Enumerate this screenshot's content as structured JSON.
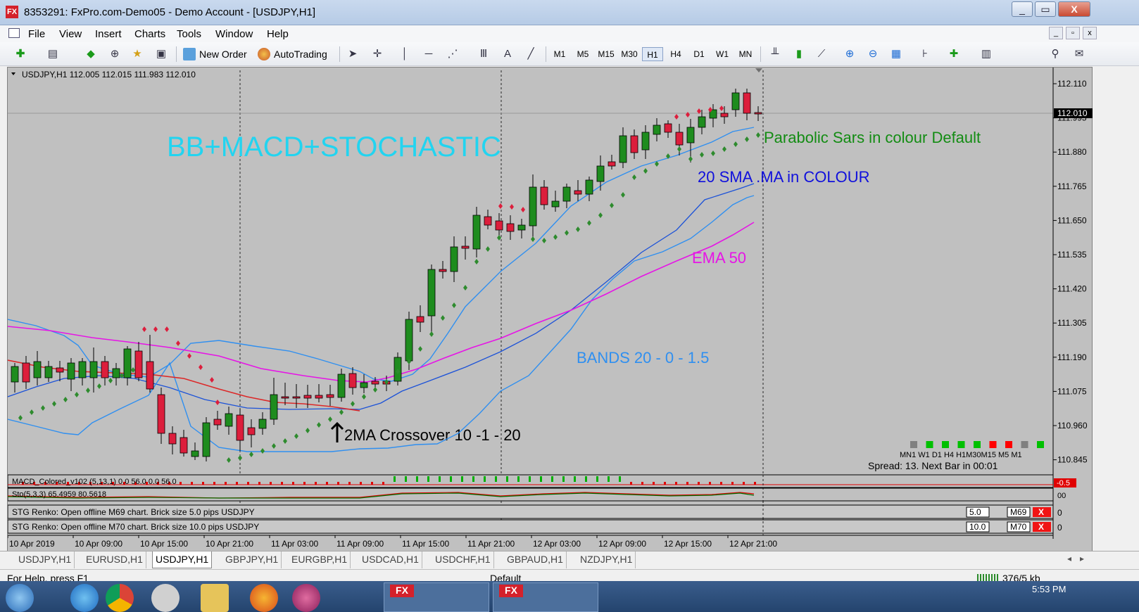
{
  "window": {
    "title": "8353291: FxPro.com-Demo05 - Demo Account - [USDJPY,H1]",
    "app_icon": "FX"
  },
  "menu": [
    "File",
    "View",
    "Insert",
    "Charts",
    "Tools",
    "Window",
    "Help"
  ],
  "toolbar": {
    "new_order": "New Order",
    "autotrading": "AutoTrading",
    "timeframes": [
      "M1",
      "M5",
      "M15",
      "M30",
      "H1",
      "H4",
      "D1",
      "W1",
      "MN"
    ],
    "active_timeframe": "H1"
  },
  "chart": {
    "header": "USDJPY,H1  112.005 112.015 111.983 112.010",
    "overlay_title": "BB+MACD+STOCHASTIC",
    "annotations": {
      "parabolic": "Parabolic Sars in colour Default",
      "sma": "20 SMA .MA in COLOUR",
      "ema": "EMA 50",
      "bands": "BANDS 20 - 0 - 1.5",
      "crossover": "2MA Crossover 10 -1 - 20"
    },
    "price_labels": [
      "112.110",
      "111.995",
      "111.880",
      "111.765",
      "111.650",
      "111.535",
      "111.420",
      "111.305",
      "111.190",
      "111.075",
      "110.960",
      "110.845"
    ],
    "current_price": "112.010",
    "time_labels": [
      "10 Apr 2019",
      "10 Apr 09:00",
      "10 Apr 15:00",
      "10 Apr 21:00",
      "11 Apr 03:00",
      "11 Apr 09:00",
      "11 Apr 15:00",
      "11 Apr 21:00",
      "12 Apr 03:00",
      "12 Apr 09:00",
      "12 Apr 15:00",
      "12 Apr 21:00"
    ],
    "tf_panel": {
      "labels": "MN1 W1  D1  H4  H1M30M15  M5  M1",
      "colors": [
        "#808080",
        "#00c000",
        "#00c000",
        "#00c000",
        "#00c000",
        "#ff0000",
        "#ff0000",
        "#808080",
        "#00c000"
      ],
      "spread": "Spread: 13. Next Bar in 00:01"
    },
    "macd_label": "MACD_Colored_v102 (5,13,1) 0.0 56.0 0.0 56.0",
    "macd_value": "-0.5",
    "stoch_label": "Sto(5,3,3) 65.4959 80.5618",
    "stoch_right": "00",
    "renko1": {
      "text": "STG Renko: Open offline M69 chart. Brick size 5.0 pips USDJPY",
      "brick": "5.0",
      "tf": "M69",
      "close": "X",
      "tail": "0"
    },
    "renko2": {
      "text": "STG Renko: Open offline M70 chart. Brick size 10.0 pips USDJPY",
      "brick": "10.0",
      "tf": "M70",
      "close": "X",
      "tail": "0"
    },
    "colors": {
      "bull": "#1e8c1e",
      "bear": "#dc1e3c",
      "sma": "#1c52d8",
      "bands": "#2f8ff0",
      "ema": "#e614e6",
      "cross": "#dc2828",
      "sar_up": "#2e8b2e",
      "sar_down": "#dc1e3c",
      "background": "#c0c0c0"
    }
  },
  "tabs": [
    "USDJPY,H1",
    "EURUSD,H1",
    "USDJPY,H1",
    "GBPJPY,H1",
    "EURGBP,H1",
    "USDCAD,H1",
    "USDCHF,H1",
    "GBPAUD,H1",
    "NZDJPY,H1"
  ],
  "active_tab": 2,
  "status": {
    "help": "For Help, press F1",
    "profile": "Default",
    "traffic": "376/5 kb"
  },
  "taskbar": {
    "time": "5:53 PM"
  }
}
